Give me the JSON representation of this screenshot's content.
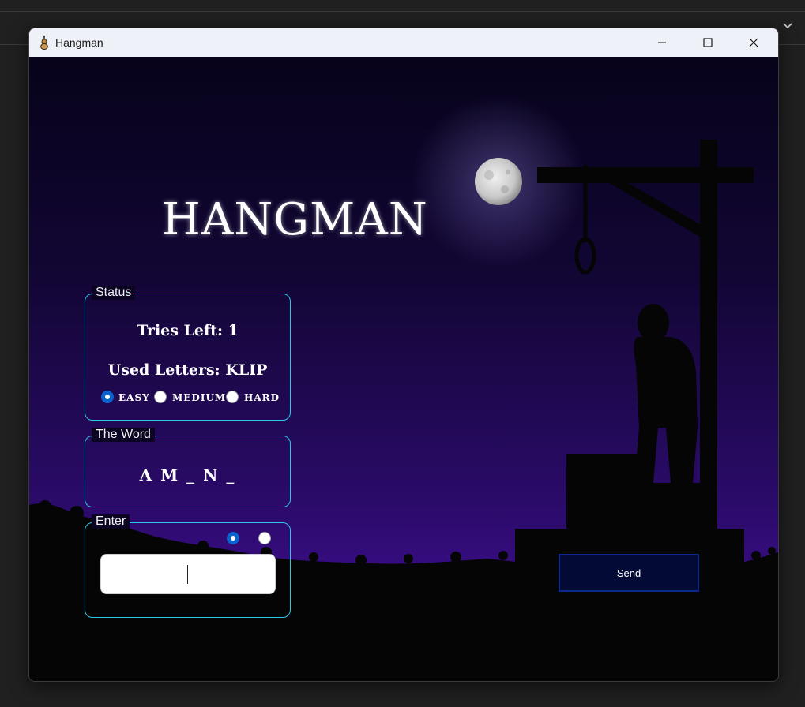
{
  "window": {
    "title": "Hangman"
  },
  "title_buttons": {
    "minimize": "minimize-icon",
    "maximize": "maximize-icon",
    "close": "close-icon"
  },
  "heading": "HANGMAN",
  "status": {
    "group_title": "Status",
    "tries_left": "Tries Left: 1",
    "used_letters": "Used Letters: KLIP",
    "difficulty": {
      "options": [
        "EASY",
        "MEDIUM",
        "HARD"
      ],
      "selected": "EASY"
    }
  },
  "word_group": {
    "group_title": "The Word",
    "word": "A M _ N _"
  },
  "enter_group": {
    "group_title": "Enter",
    "input_value": ""
  },
  "send_button": "Send",
  "colors": {
    "accent_border": "#2ec6e6",
    "radio_selected": "#0b63ce",
    "sky_top": "#08031e",
    "sky_bottom": "#3a0c88"
  }
}
